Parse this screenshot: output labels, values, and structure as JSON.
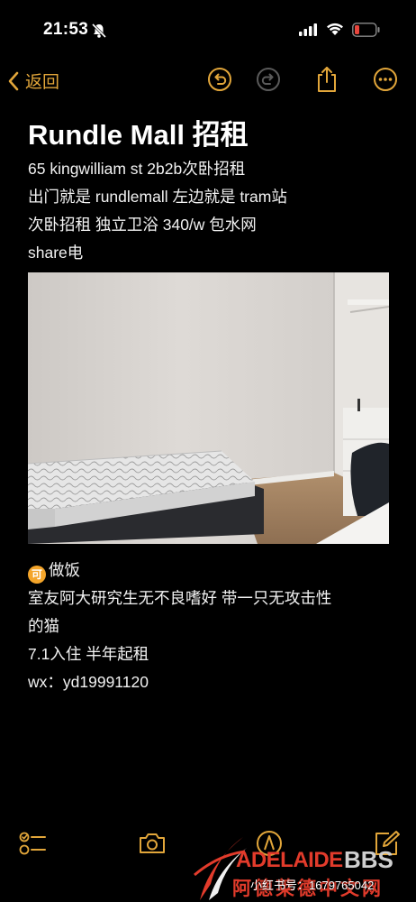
{
  "status_bar": {
    "time": "21:53",
    "icons": [
      "bell-slash-icon",
      "cellular-signal-icon",
      "wifi-icon",
      "battery-low-icon"
    ],
    "battery_color": "#e8453c"
  },
  "nav": {
    "back_label": "返回",
    "accent_color": "#e2a63a",
    "icons": [
      "undo-icon",
      "redo-icon",
      "share-icon",
      "more-icon"
    ]
  },
  "note": {
    "title": "Rundle Mall 招租",
    "intro_lines": [
      "65 kingwilliam st 2b2b次卧招租",
      "出门就是 rundlemall 左边就是 tram站",
      "次卧招租 独立卫浴 340/w 包水网",
      "share电"
    ],
    "image": "bedroom-photo",
    "cook_badge": "可",
    "detail_lines": [
      "做饭",
      "室友阿大研究生无不良嗜好 带一只无攻击性",
      "的猫",
      "7.1入住 半年起租",
      "wx：yd19991120"
    ]
  },
  "toolbar": {
    "icons": [
      "checklist-icon",
      "camera-icon",
      "markup-pen-icon",
      "compose-icon"
    ]
  },
  "watermark": {
    "brand": "ADELAIDE",
    "brand_suffix": "BBS",
    "site_name": "阿德莱德中文网",
    "handle": "小红书号：1679765042"
  }
}
